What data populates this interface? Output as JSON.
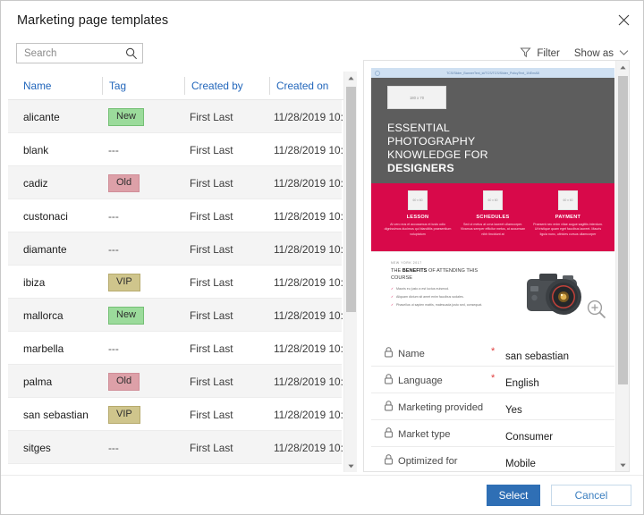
{
  "dialog": {
    "title": "Marketing page templates",
    "close_icon": "close-icon"
  },
  "search": {
    "placeholder": "Search",
    "value": "",
    "icon": "search-icon"
  },
  "toolbar": {
    "filter_label": "Filter",
    "filter_icon": "filter-funnel-icon",
    "show_as_label": "Show as",
    "show_as_icon": "chevron-down-icon"
  },
  "table": {
    "columns": [
      "Name",
      "Tag",
      "Created by",
      "Created on"
    ],
    "header_color": "#2266bb",
    "rows": [
      {
        "name": "alicante",
        "tag": "New",
        "tag_style": "new",
        "created_by": "First Last",
        "created_on": "11/28/2019 10:..."
      },
      {
        "name": "blank",
        "tag": "---",
        "tag_style": "none",
        "created_by": "First Last",
        "created_on": "11/28/2019 10:..."
      },
      {
        "name": "cadiz",
        "tag": "Old",
        "tag_style": "old",
        "created_by": "First Last",
        "created_on": "11/28/2019 10:..."
      },
      {
        "name": "custonaci",
        "tag": "---",
        "tag_style": "none",
        "created_by": "First Last",
        "created_on": "11/28/2019 10:..."
      },
      {
        "name": "diamante",
        "tag": "---",
        "tag_style": "none",
        "created_by": "First Last",
        "created_on": "11/28/2019 10:..."
      },
      {
        "name": "ibiza",
        "tag": "VIP",
        "tag_style": "vip",
        "created_by": "First Last",
        "created_on": "11/28/2019 10:..."
      },
      {
        "name": "mallorca",
        "tag": "New",
        "tag_style": "new",
        "created_by": "First Last",
        "created_on": "11/28/2019 10:..."
      },
      {
        "name": "marbella",
        "tag": "---",
        "tag_style": "none",
        "created_by": "First Last",
        "created_on": "11/28/2019 10:..."
      },
      {
        "name": "palma",
        "tag": "Old",
        "tag_style": "old",
        "created_by": "First Last",
        "created_on": "11/28/2019 10:..."
      },
      {
        "name": "san sebastian",
        "tag": "VIP",
        "tag_style": "vip",
        "created_by": "First Last",
        "created_on": "11/28/2019 10:..."
      },
      {
        "name": "sitges",
        "tag": "---",
        "tag_style": "none",
        "created_by": "First Last",
        "created_on": "11/28/2019 10:..."
      }
    ],
    "tag_colors": {
      "new": "#9bdb9b",
      "old": "#dda0a8",
      "vip": "#cfc58c"
    }
  },
  "preview": {
    "browser_url": "TCS/Slider_BannerText_id/TCS/TCS/Slider_PolicyText_1NEmAB",
    "logo_placeholder": "180 x 70",
    "hero_lines": [
      "ESSENTIAL",
      "PHOTOGRAPHY",
      "KNOWLEDGE FOR"
    ],
    "hero_bold_line": "DESIGNERS",
    "band_color": "#d8094a",
    "hero_color": "#5d5d5d",
    "band_columns": [
      {
        "placeholder": "60 x 60",
        "heading": "LESSON",
        "body": "At vero eos et accusamus et iusto odio dignissimos ducimus qui blanditiis praesentium voluptatum"
      },
      {
        "placeholder": "60 x 60",
        "heading": "SCHEDULES",
        "body": "Sed ut metus at urna laoreet ullamcorper. Vivamus semper efficitur metus, at accumsan nibh tincidunt at"
      },
      {
        "placeholder": "60 x 60",
        "heading": "PAYMENT",
        "body": "Praesent nec enim vitae augue sagittis interdum. Ut tristique quam eget faucibus laoreet. Mauris ligula nunc, ultricies cursus ullamcorper"
      }
    ],
    "lower": {
      "eyebrow": "NEW YORK 2017",
      "title_prefix": "THE ",
      "title_bold": "BENEFITS",
      "title_suffix": " OF ATTENDING THIS COURSE",
      "bullets": [
        "Mauris eu justo a est luctus euismod.",
        "Aliquam dictum sit amet enim faucibus sodales.",
        "Phasellus ut sapien mattis, malesuada justo sed, consequat."
      ],
      "image_alt": "dslr-camera-photo",
      "zoom_icon": "magnifier-zoom-icon"
    }
  },
  "properties": [
    {
      "label": "Name",
      "required": "*",
      "value": "san sebastian",
      "icon": "lock-icon"
    },
    {
      "label": "Language",
      "required": "*",
      "value": "English",
      "icon": "lock-icon"
    },
    {
      "label": "Marketing provided",
      "required": "",
      "value": "Yes",
      "icon": "lock-icon"
    },
    {
      "label": "Market type",
      "required": "",
      "value": "Consumer",
      "icon": "lock-icon"
    },
    {
      "label": "Optimized for",
      "required": "",
      "value": "Mobile",
      "icon": "lock-icon"
    }
  ],
  "footer": {
    "select_label": "Select",
    "cancel_label": "Cancel",
    "select_color": "#2f6fb5"
  }
}
